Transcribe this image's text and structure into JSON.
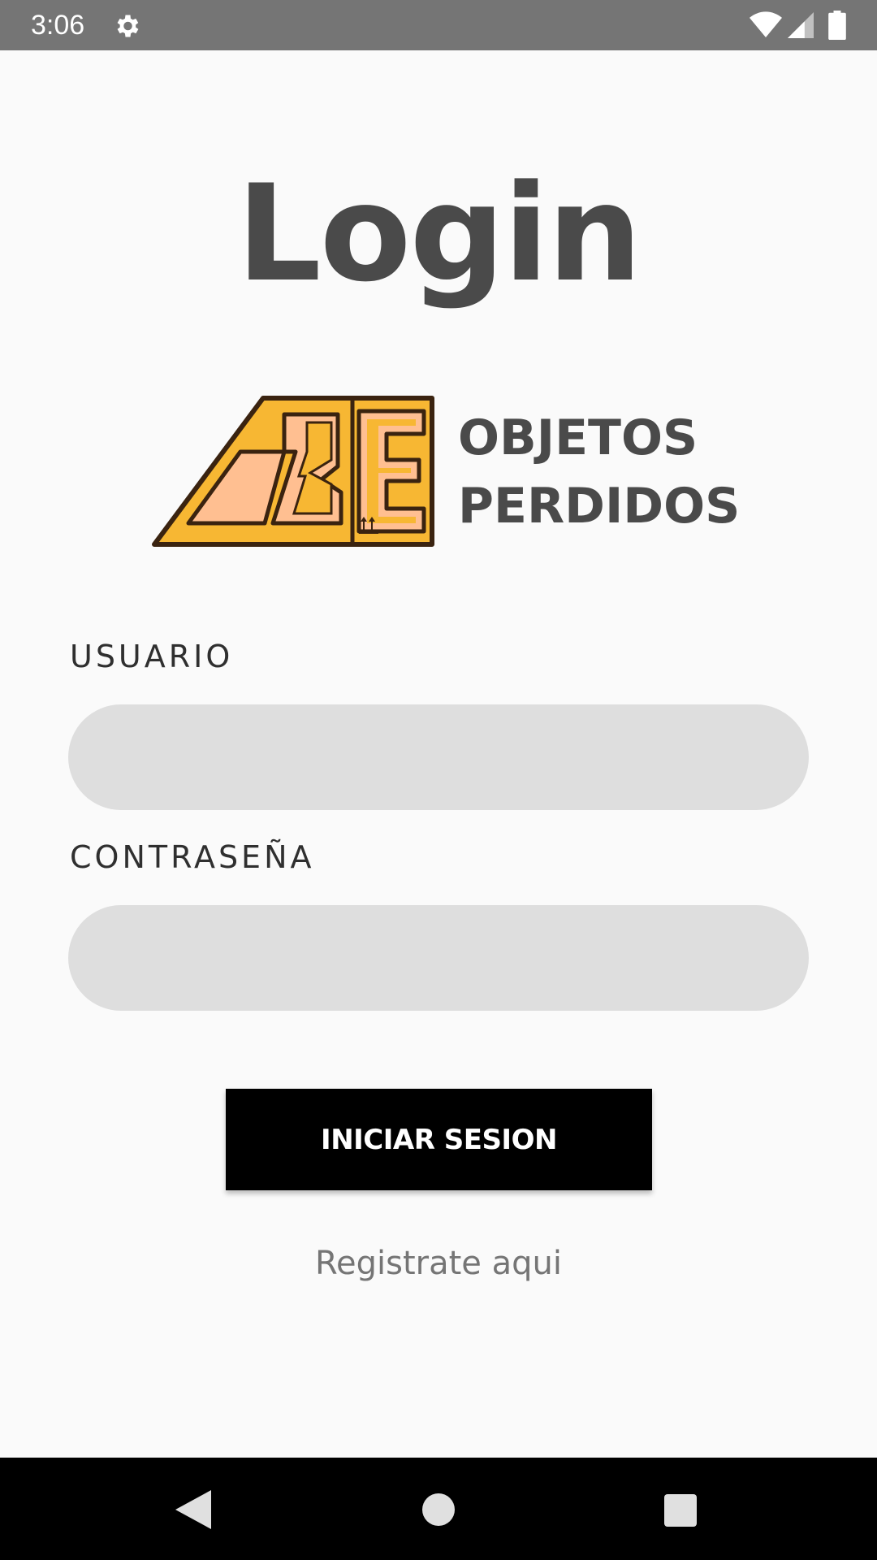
{
  "status_bar": {
    "time": "3:06",
    "icons": [
      "gear-icon",
      "wifi-icon",
      "signal-icon",
      "battery-icon"
    ]
  },
  "page": {
    "title": "Login"
  },
  "logo": {
    "line1": "OBJETOS",
    "line2": "PERDIDOS",
    "colors": {
      "frame": "#f7b733",
      "fill": "#ffbf91",
      "outline": "#3a2310"
    }
  },
  "form": {
    "username_label": "USUARIO",
    "username_value": "",
    "password_label": "CONTRASEÑA",
    "password_value": "",
    "submit_label": "INICIAR SESION",
    "register_link": "Registrate aqui"
  },
  "nav_bar": {
    "icons": [
      "back-icon",
      "home-icon",
      "recents-icon"
    ]
  },
  "colors": {
    "background": "#fafafa",
    "input_background": "#dedede",
    "button_background": "#000000",
    "title_color": "#4a4a4a",
    "status_bar": "#757575"
  }
}
